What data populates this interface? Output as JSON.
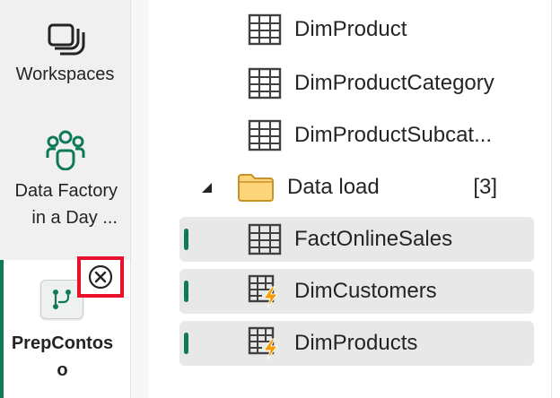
{
  "rail": {
    "workspaces_label": "Workspaces",
    "datafactory_label_line1": "Data Factory",
    "datafactory_label_line2": "in a Day ...",
    "active_label_line1": "PrepContos",
    "active_label_line2": "o"
  },
  "tree": {
    "items": [
      {
        "label": "DimProduct"
      },
      {
        "label": "DimProductCategory"
      },
      {
        "label": "DimProductSubcat..."
      }
    ],
    "folder": {
      "label": "Data load",
      "count": "[3]"
    },
    "queries": [
      {
        "label": "FactOnlineSales",
        "icon": "table-icon"
      },
      {
        "label": "DimCustomers",
        "icon": "table-lightning-icon"
      },
      {
        "label": "DimProducts",
        "icon": "table-lightning-icon"
      }
    ]
  },
  "colors": {
    "accent": "#0e7a5a",
    "highlight": "#e8102a",
    "lightning": "#f59d00"
  }
}
